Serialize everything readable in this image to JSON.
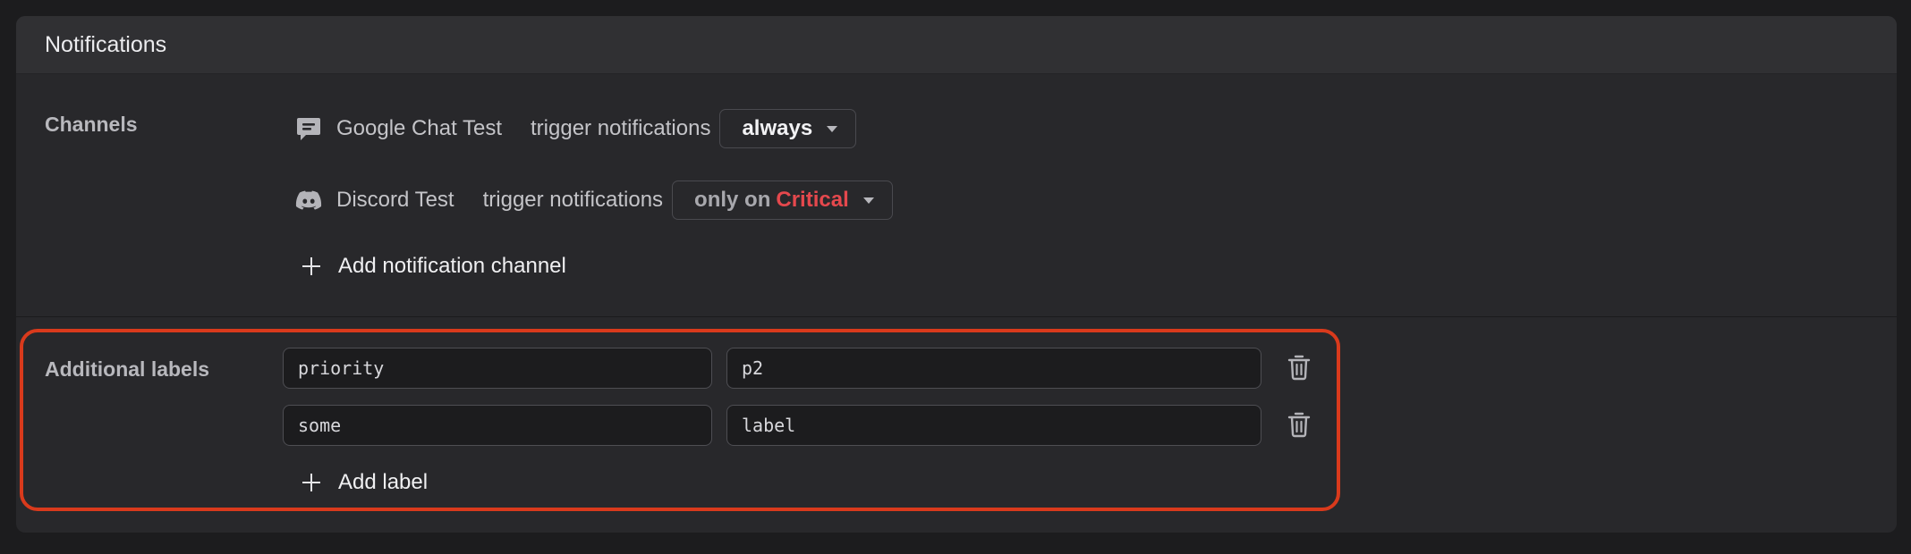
{
  "panel": {
    "title": "Notifications"
  },
  "channels": {
    "label": "Channels",
    "items": [
      {
        "name": "Google Chat Test",
        "icon": "google-chat-icon",
        "trigger_label": "trigger notifications",
        "selected": "always"
      },
      {
        "name": "Discord Test",
        "icon": "discord-icon",
        "trigger_label": "trigger notifications",
        "selected_prefix": "only on",
        "selected_severity": "Critical"
      }
    ],
    "add_label": "Add notification channel"
  },
  "labels": {
    "label": "Additional labels",
    "rows": [
      {
        "key": "priority",
        "value": "p2"
      },
      {
        "key": "some",
        "value": "label"
      }
    ],
    "add_label": "Add label"
  },
  "colors": {
    "critical": "#e5484d",
    "highlight_border": "#d93a1c"
  }
}
